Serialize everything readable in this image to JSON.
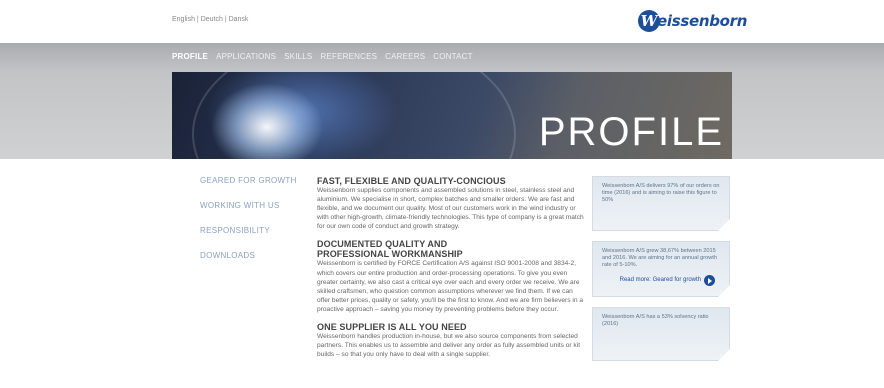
{
  "languages": [
    "English",
    "Deutch",
    "Dansk"
  ],
  "language_separator": " | ",
  "logo": {
    "mark": "W",
    "text": "eissenborn"
  },
  "nav": [
    "PROFILE",
    "APPLICATIONS",
    "SKILLS",
    "REFERENCES",
    "CAREERS",
    "CONTACT"
  ],
  "hero": {
    "title": "PROFILE"
  },
  "sidebar": {
    "items": [
      "GEARED FOR GROWTH",
      "WORKING WITH US",
      "RESPONSIBILITY",
      "DOWNLOADS"
    ]
  },
  "main": {
    "sections": [
      {
        "heading": "FAST, FLEXIBLE AND QUALITY-CONCIOUS",
        "body": "Weissenborn supplies components and assembled solutions in steel, stainless steel and aluminium. We specialise in short, complex batches and smaller orders. We are fast and flexible, and we document our quality. Most of our customers work in the wind industry or with other high-growth, climate-friendly technologies. This type of company is a great match for our own code of conduct and growth strategy."
      },
      {
        "heading": "DOCUMENTED QUALITY AND PROFESSIONAL WORKMANSHIP",
        "body": "Weissenborn is certified by FORCE Certification A/S against ISO 9001-2008 and 3834-2, which covers our entire production and order-processing operations. To give you even greater certainty, we also cast a critical eye over each and every order we receive. We are skilled craftsmen, who question common assumptions wherever we find them. If we can offer better prices, quality or safety, you'll be the first to know. And we are firm believers in a proactive approach – saving you money by preventing problems before they occur."
      },
      {
        "heading": "ONE SUPPLIER IS ALL YOU NEED",
        "body": "Weissenborn handles production in-house, but we also source components from selected partners. This enables us to assemble and deliver any order as fully assembled units or kit builds – so that you only have to deal with a single supplier."
      }
    ]
  },
  "facts": [
    {
      "text": "Weissenborn A/S delivers 97% of our orders on time (2016) and is aiming to raise this figure to 50%"
    },
    {
      "text": "Weissenborn A/S grew 38,67% between 2015 and 2016. We are aiming for an annual growth rate of 5-10%.",
      "link": "Read more: Geared for growth"
    },
    {
      "text": "Weissenborn A/S has a 53% solvency ratio (2016)"
    }
  ]
}
